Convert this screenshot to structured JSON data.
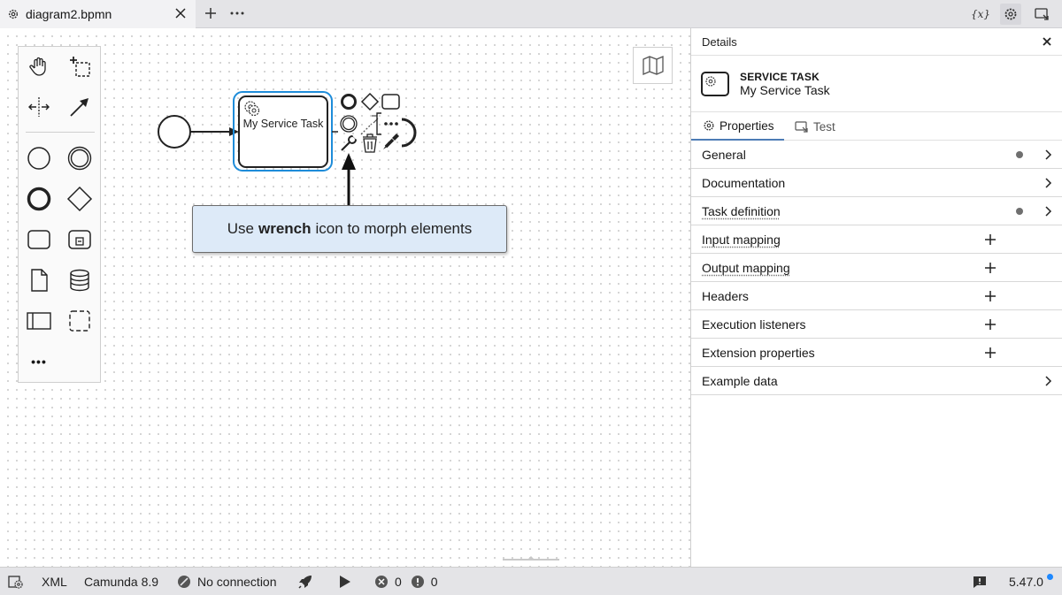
{
  "tabbar": {
    "tab_title": "diagram2.bpmn",
    "icons": [
      "gear-icon",
      "close-icon",
      "plus-icon",
      "more-icon",
      "variables-icon",
      "settings-icon",
      "preview-icon"
    ],
    "variables_label": "{x}"
  },
  "palette": {
    "tools": [
      "hand-tool",
      "lasso-tool",
      "space-tool",
      "global-connect-tool",
      "start-event",
      "intermediate-event",
      "end-event",
      "gateway",
      "task",
      "subprocess",
      "data-object",
      "data-store",
      "participant",
      "group",
      "more-tools"
    ],
    "more_label": "•••"
  },
  "diagram": {
    "task_name": "My Service Task",
    "selection_color": "#1e8cd9"
  },
  "tooltip": {
    "prefix": "Use",
    "emphasis": "wrench",
    "suffix": "icon to morph elements",
    "background": "#ddeaf8"
  },
  "panel": {
    "title": "Details",
    "element_type": "SERVICE TASK",
    "element_name": "My Service Task",
    "tabs": [
      "Properties",
      "Test"
    ],
    "groups": [
      {
        "label": "General",
        "dot": true,
        "action": "chevron"
      },
      {
        "label": "Documentation",
        "dot": false,
        "action": "chevron"
      },
      {
        "label": "Task definition",
        "dot": true,
        "action": "chevron"
      },
      {
        "label": "Input mapping",
        "dot": false,
        "action": "add"
      },
      {
        "label": "Output mapping",
        "dot": false,
        "action": "add"
      },
      {
        "label": "Headers",
        "dot": false,
        "action": "add"
      },
      {
        "label": "Execution listeners",
        "dot": false,
        "action": "add"
      },
      {
        "label": "Extension properties",
        "dot": false,
        "action": "add"
      },
      {
        "label": "Example data",
        "dot": false,
        "action": "chevron"
      }
    ]
  },
  "statusbar": {
    "xml": "XML",
    "engine": "Camunda 8.9",
    "connection": "No connection",
    "errors": "0",
    "warnings": "0",
    "version": "5.47.0",
    "accent": "#1e88ff"
  }
}
